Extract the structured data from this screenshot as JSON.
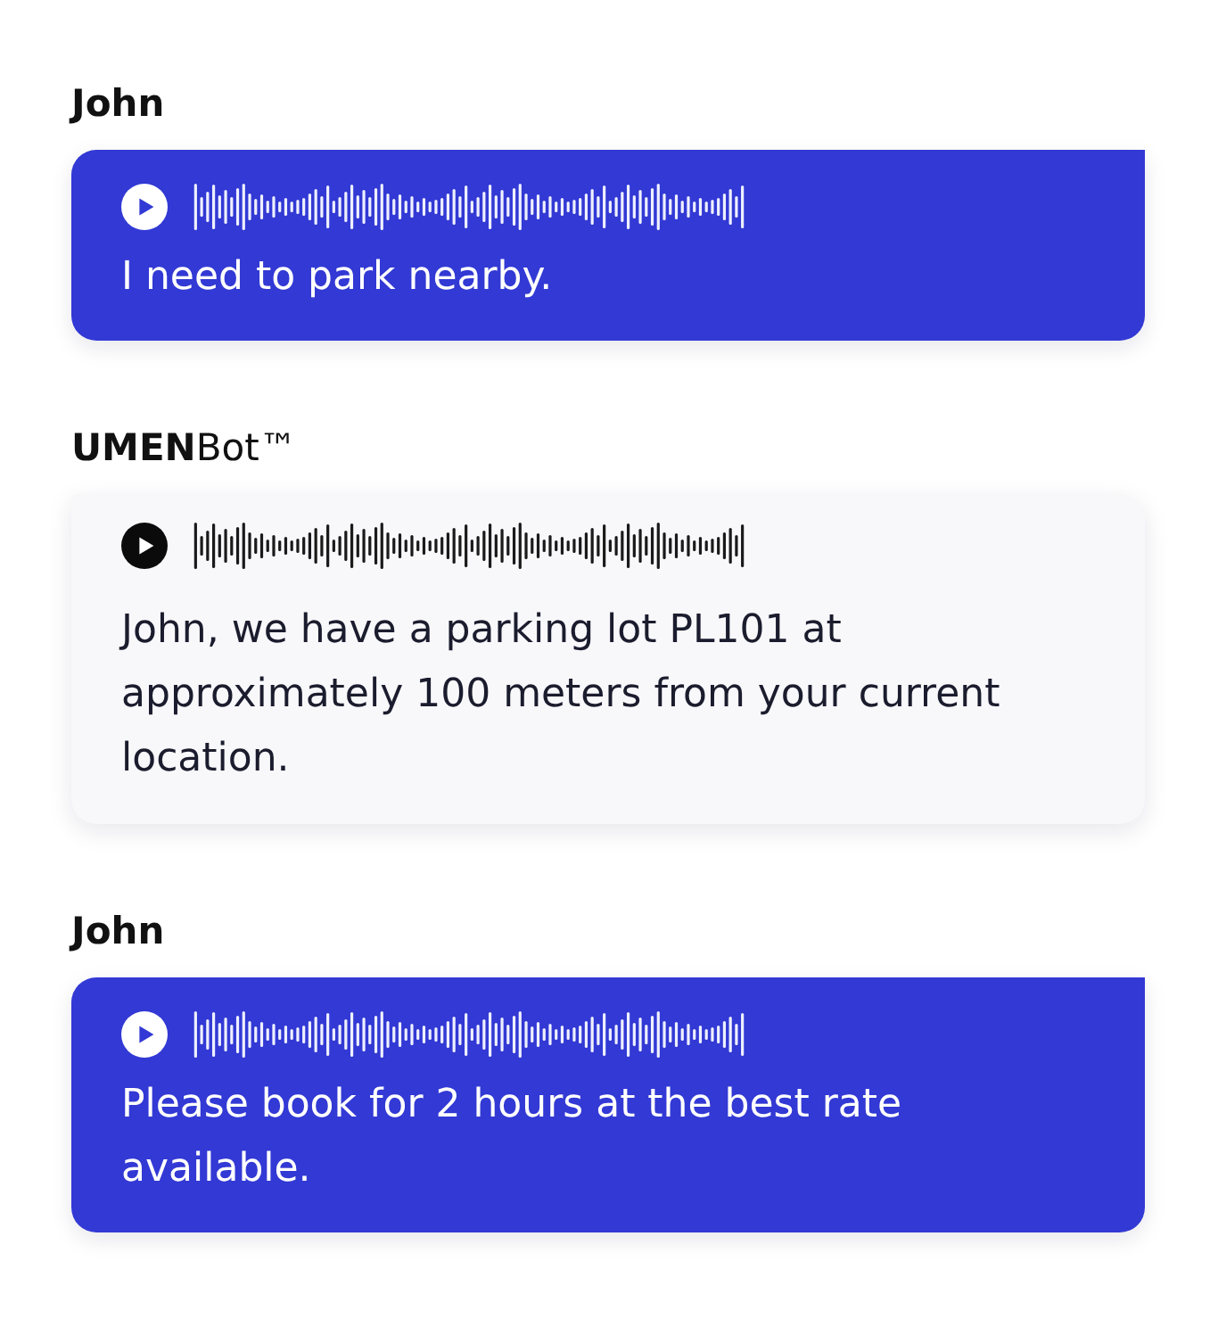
{
  "messages": [
    {
      "sender": "John",
      "kind": "user",
      "text": "I need to park nearby."
    },
    {
      "sender": "**UMEN**Bot™",
      "kind": "bot",
      "text": "John, we have a parking lot PL101 at approximately 100 meters from your current location."
    },
    {
      "sender": "John",
      "kind": "user",
      "text": "Please book for 2 hours at the best rate available."
    }
  ]
}
